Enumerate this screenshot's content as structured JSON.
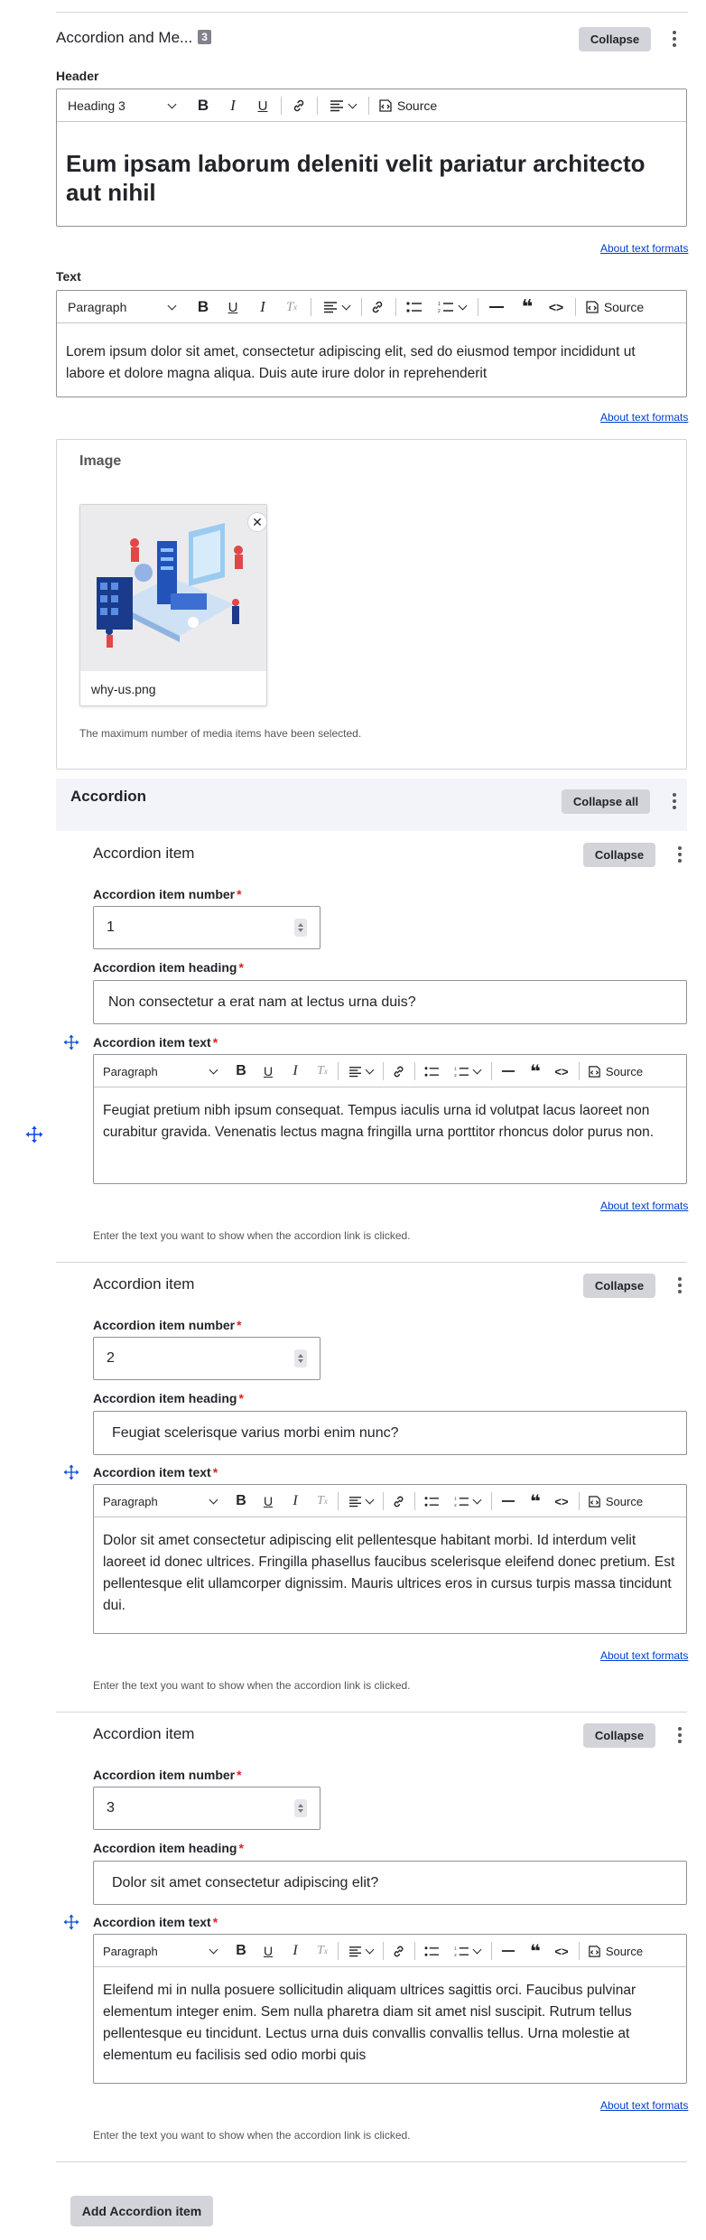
{
  "block": {
    "title": "Accordion and Me...",
    "badge": "3",
    "collapse": "Collapse"
  },
  "header": {
    "label": "Header",
    "format": "Heading 3",
    "source": "Source",
    "content": "Eum ipsam laborum deleniti velit pariatur architecto aut nihil",
    "about_link": "About text formats"
  },
  "text": {
    "label": "Text",
    "format": "Paragraph",
    "source": "Source",
    "content": "Lorem ipsum dolor sit amet, consectetur adipiscing elit, sed do eiusmod tempor incididunt ut labore et dolore magna aliqua. Duis aute irure dolor in reprehenderit",
    "about_link": "About text formats"
  },
  "image": {
    "label": "Image",
    "filename": "why-us.png",
    "note": "The maximum number of media items have been selected."
  },
  "accordion": {
    "label": "Accordion",
    "collapse_all": "Collapse all",
    "add_button": "Add Accordion item",
    "items": [
      {
        "title": "Accordion item",
        "collapse": "Collapse",
        "number_label": "Accordion item number",
        "number": "1",
        "heading_label": "Accordion item heading",
        "heading": "Non consectetur a erat nam at lectus urna duis?",
        "text_label": "Accordion item text",
        "format": "Paragraph",
        "source": "Source",
        "text": "Feugiat pretium nibh ipsum consequat. Tempus iaculis urna id volutpat lacus laoreet non curabitur gravida. Venenatis lectus magna fringilla urna porttitor rhoncus dolor purus non.",
        "about_link": "About text formats",
        "help": "Enter the text you want to show when the accordion link is clicked."
      },
      {
        "title": "Accordion item",
        "collapse": "Collapse",
        "number_label": "Accordion item number",
        "number": "2",
        "heading_label": "Accordion item heading",
        "heading": "Feugiat scelerisque varius morbi enim nunc?",
        "text_label": "Accordion item text",
        "format": "Paragraph",
        "source": "Source",
        "text": "Dolor sit amet consectetur adipiscing elit pellentesque habitant morbi. Id interdum velit laoreet id donec ultrices. Fringilla phasellus faucibus scelerisque eleifend donec pretium. Est pellentesque elit ullamcorper dignissim. Mauris ultrices eros in cursus turpis massa tincidunt dui.",
        "about_link": "About text formats",
        "help": "Enter the text you want to show when the accordion link is clicked."
      },
      {
        "title": "Accordion item",
        "collapse": "Collapse",
        "number_label": "Accordion item number",
        "number": "3",
        "heading_label": "Accordion item heading",
        "heading": "Dolor sit amet consectetur adipiscing elit?",
        "text_label": "Accordion item text",
        "format": "Paragraph",
        "source": "Source",
        "text": "Eleifend mi in nulla posuere sollicitudin aliquam ultrices sagittis orci. Faucibus pulvinar elementum integer enim. Sem nulla pharetra diam sit amet nisl suscipit. Rutrum tellus pellentesque eu tincidunt. Lectus urna duis convallis convallis tellus. Urna molestie at elementum eu facilisis sed odio morbi quis",
        "about_link": "About text formats",
        "help": "Enter the text you want to show when the accordion link is clicked."
      }
    ]
  },
  "colors": {
    "link": "#003ecc",
    "required": "#dc2323",
    "button_bg": "#d3d4d9",
    "section_bg": "#f3f4f9",
    "move_icon": "#004adc"
  }
}
